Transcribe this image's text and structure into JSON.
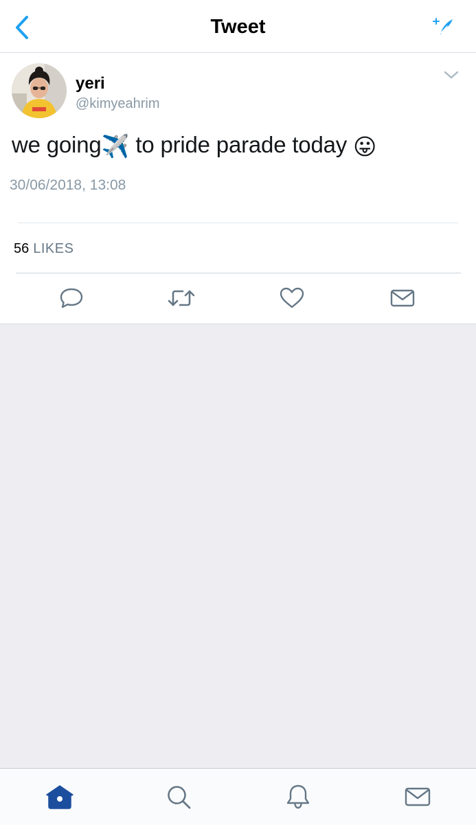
{
  "header": {
    "title": "Tweet",
    "back_icon": "chevron-left-icon",
    "compose_icon": "feather-sparkle-icon"
  },
  "tweet": {
    "display_name": "yeri",
    "handle": "@kimyeahrim",
    "text_part1": "we going",
    "emoji_1": "✈️",
    "text_part2": " to pride parade today ",
    "emoji_2": "😛",
    "timestamp": "30/06/2018, 13:08",
    "likes_count": "56",
    "likes_label": "LIKES"
  },
  "actions": [
    {
      "name": "reply",
      "icon": "comment-icon"
    },
    {
      "name": "retweet",
      "icon": "retweet-icon"
    },
    {
      "name": "like",
      "icon": "heart-icon"
    },
    {
      "name": "direct-message",
      "icon": "envelope-icon"
    }
  ],
  "tabbar": {
    "tabs": [
      {
        "name": "home",
        "icon": "home-icon",
        "active": true
      },
      {
        "name": "search",
        "icon": "search-icon",
        "active": false
      },
      {
        "name": "notifications",
        "icon": "bell-icon",
        "active": false
      },
      {
        "name": "messages",
        "icon": "envelope-icon",
        "active": false
      }
    ]
  },
  "colors": {
    "accent": "#1da1f2",
    "active_tab": "#1c4e9e",
    "icon_gray": "#657786",
    "secondary_text": "#8899a6",
    "empty_background": "#ededf2"
  }
}
